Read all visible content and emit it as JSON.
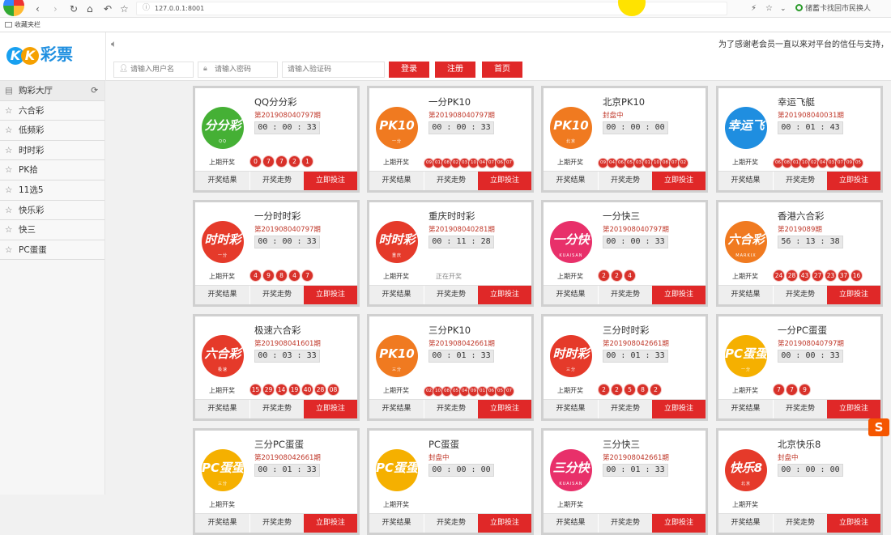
{
  "browser": {
    "url": "127.0.0.1:8001",
    "right_search": "储蓄卡找回市民换人",
    "bookmark": "收藏夹栏"
  },
  "site": {
    "logo_k": "K",
    "logo_text": "彩票",
    "marquee": "为了感谢老会员一直以来对平台的信任与支持，",
    "username_placeholder": "请输入用户名",
    "password_placeholder": "请输入密码",
    "captcha_placeholder": "请输入验证码",
    "login": "登录",
    "register": "注册",
    "home": "首页"
  },
  "colors": {
    "accent": "#e02828",
    "issue": "#c0392b"
  },
  "sidebar": [
    {
      "label": "购彩大厅",
      "icon": "list-icon"
    },
    {
      "label": "六合彩",
      "icon": "star-icon"
    },
    {
      "label": "低频彩",
      "icon": "star-icon"
    },
    {
      "label": "时时彩",
      "icon": "star-icon"
    },
    {
      "label": "PK拾",
      "icon": "star-icon"
    },
    {
      "label": "11选5",
      "icon": "star-icon"
    },
    {
      "label": "快乐彩",
      "icon": "star-icon"
    },
    {
      "label": "快三",
      "icon": "star-icon"
    },
    {
      "label": "PC蛋蛋",
      "icon": "star-icon"
    }
  ],
  "card_labels": {
    "last": "上期开奖",
    "results": "开奖结果",
    "trend": "开奖走势",
    "bet": "立即投注"
  },
  "games": [
    {
      "title": "QQ分分彩",
      "issue": "第201908040797期",
      "timer": "00 : 00 : 33",
      "logo_text": "分分彩",
      "logo_sub": "QQ",
      "logo_color": "#45b035",
      "balls": [
        "0",
        "7",
        "7",
        "2",
        "1"
      ]
    },
    {
      "title": "一分PK10",
      "issue": "第201908040797期",
      "timer": "00 : 00 : 33",
      "logo_text": "PK10",
      "logo_sub": "一分",
      "logo_color": "#f07a20",
      "balls": [
        "09",
        "01",
        "08",
        "02",
        "03",
        "10",
        "04",
        "07",
        "06",
        "07"
      ],
      "small": true
    },
    {
      "title": "北京PK10",
      "issue": "封盘中",
      "timer": "00 : 00 : 00",
      "logo_text": "PK10",
      "logo_sub": "北京",
      "logo_color": "#f07a20",
      "balls": [
        "09",
        "04",
        "06",
        "05",
        "03",
        "01",
        "10",
        "08",
        "07",
        "02"
      ],
      "small": true
    },
    {
      "title": "幸运飞艇",
      "issue": "第201908040031期",
      "timer": "00 : 01 : 43",
      "logo_text": "幸运飞艇",
      "logo_sub": "",
      "logo_color": "#1f8ee0",
      "balls": [
        "06",
        "08",
        "01",
        "10",
        "02",
        "04",
        "03",
        "07",
        "09",
        "05"
      ],
      "small": true
    },
    {
      "title": "一分时时彩",
      "issue": "第201908040797期",
      "timer": "00 : 00 : 33",
      "logo_text": "时时彩",
      "logo_sub": "一分",
      "logo_color": "#e53a2a",
      "balls": [
        "4",
        "9",
        "8",
        "4",
        "7"
      ]
    },
    {
      "title": "重庆时时彩",
      "issue": "第201908040281期",
      "timer": "00 : 11 : 28",
      "logo_text": "时时彩",
      "logo_sub": "重庆",
      "logo_color": "#e53a2a",
      "balls": [],
      "status": "正在开奖"
    },
    {
      "title": "一分快三",
      "issue": "第201908040797期",
      "timer": "00 : 00 : 33",
      "logo_text": "一分快",
      "logo_sub": "KUAISAN",
      "logo_color": "#e8306a",
      "balls": [
        "2",
        "2",
        "4"
      ]
    },
    {
      "title": "香港六合彩",
      "issue": "第2019089期",
      "timer": "56 : 13 : 38",
      "logo_text": "六合彩",
      "logo_sub": "MARKIX",
      "logo_color": "#f07a20",
      "balls": [
        "24",
        "28",
        "43",
        "27",
        "23",
        "37",
        "16"
      ]
    },
    {
      "title": "极速六合彩",
      "issue": "第201908041601期",
      "timer": "00 : 03 : 33",
      "logo_text": "六合彩",
      "logo_sub": "极速",
      "logo_color": "#e53a2a",
      "balls": [
        "15",
        "29",
        "14",
        "19",
        "40",
        "28",
        "08"
      ]
    },
    {
      "title": "三分PK10",
      "issue": "第201908042661期",
      "timer": "00 : 01 : 33",
      "logo_text": "PK10",
      "logo_sub": "三分",
      "logo_color": "#f07a20",
      "balls": [
        "02",
        "10",
        "08",
        "05",
        "04",
        "09",
        "01",
        "06",
        "05",
        "07"
      ],
      "small": true
    },
    {
      "title": "三分时时彩",
      "issue": "第201908042661期",
      "timer": "00 : 01 : 33",
      "logo_text": "时时彩",
      "logo_sub": "三分",
      "logo_color": "#e53a2a",
      "balls": [
        "2",
        "2",
        "5",
        "8",
        "2"
      ]
    },
    {
      "title": "一分PC蛋蛋",
      "issue": "第201908040797期",
      "timer": "00 : 00 : 33",
      "logo_text": "PC蛋蛋",
      "logo_sub": "一分",
      "logo_color": "#f5b000",
      "balls": [
        "7",
        "7",
        "9"
      ]
    },
    {
      "title": "三分PC蛋蛋",
      "issue": "第201908042661期",
      "timer": "00 : 01 : 33",
      "logo_text": "PC蛋蛋",
      "logo_sub": "三分",
      "logo_color": "#f5b000",
      "balls": []
    },
    {
      "title": "PC蛋蛋",
      "issue": "封盘中",
      "timer": "00 : 00 : 00",
      "logo_text": "PC蛋蛋",
      "logo_sub": "",
      "logo_color": "#f5b000",
      "balls": []
    },
    {
      "title": "三分快三",
      "issue": "第201908042661期",
      "timer": "00 : 01 : 33",
      "logo_text": "三分快",
      "logo_sub": "KUAISAN",
      "logo_color": "#e8306a",
      "balls": []
    },
    {
      "title": "北京快乐8",
      "issue": "封盘中",
      "timer": "00 : 00 : 00",
      "logo_text": "快乐8",
      "logo_sub": "北京",
      "logo_color": "#e53a2a",
      "balls": []
    }
  ]
}
